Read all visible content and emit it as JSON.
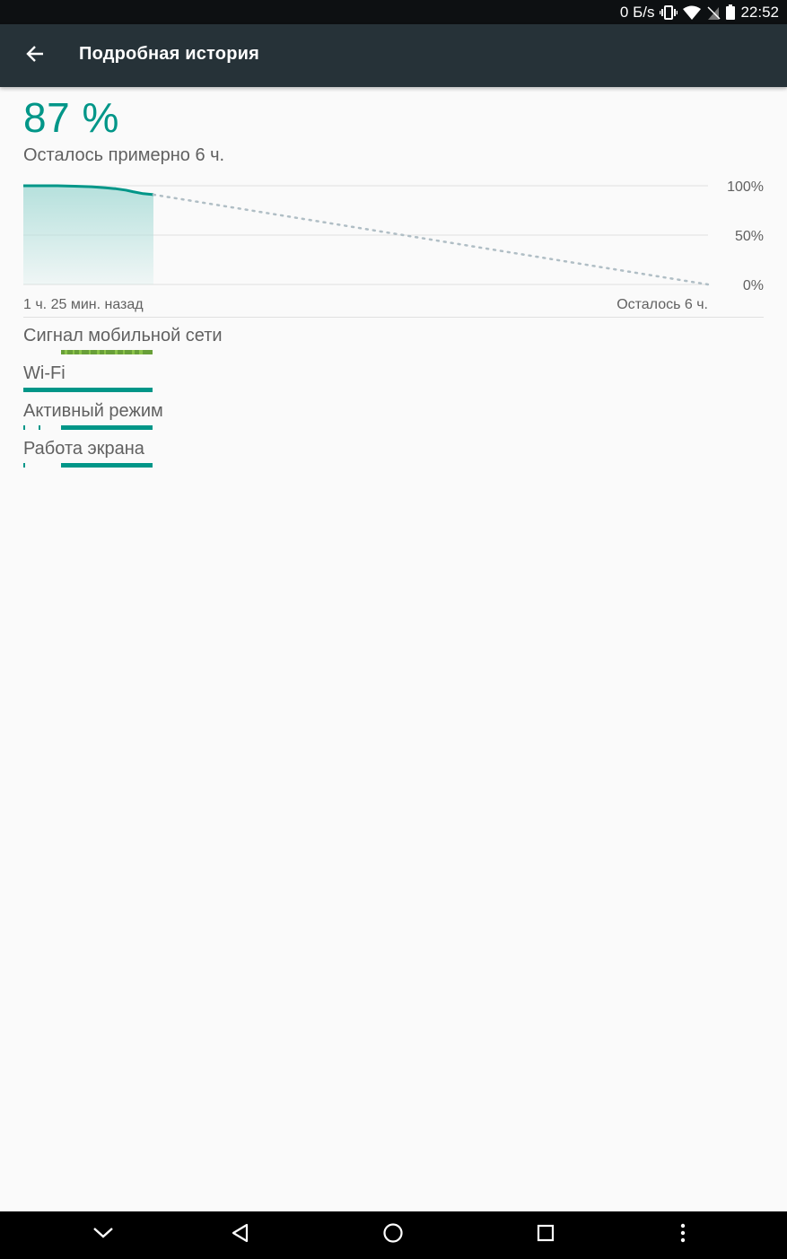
{
  "status_bar": {
    "net_speed": "0 Б/s",
    "time": "22:52",
    "icons": [
      "vibrate-icon",
      "wifi-icon",
      "no-sim-icon",
      "battery-icon"
    ]
  },
  "app_bar": {
    "back_icon": "arrow-back-icon",
    "title": "Подробная история"
  },
  "battery": {
    "level": "87 %",
    "remaining": "Осталось примерно 6 ч."
  },
  "chart_data": {
    "type": "line",
    "x_start_label": "1 ч. 25 мин. назад",
    "x_end_label": "Осталось 6 ч.",
    "y_tick_labels": [
      "100%",
      "50%",
      "0%"
    ],
    "ylim": [
      0,
      100
    ],
    "xlim": [
      0,
      1
    ],
    "actual": {
      "x": [
        0.0,
        0.025,
        0.05,
        0.075,
        0.1,
        0.12,
        0.135,
        0.15,
        0.16,
        0.175,
        0.19
      ],
      "y": [
        100,
        100,
        100,
        99.5,
        99,
        98,
        97,
        95.5,
        94,
        92,
        91
      ]
    },
    "projected": {
      "x": [
        0.19,
        1.0
      ],
      "y": [
        91,
        0
      ]
    },
    "grid": true,
    "colors": {
      "line": "#009688",
      "fill": "#b2dfdb",
      "projection": "#b0bec5",
      "grid": "#e0e0e0"
    }
  },
  "rows": [
    {
      "label": "Сигнал мобильной сети",
      "type": "signal"
    },
    {
      "label": "Wi-Fi",
      "type": "wifi"
    },
    {
      "label": "Активный режим",
      "type": "active"
    },
    {
      "label": "Работа экрана",
      "type": "screen"
    }
  ],
  "nav_bar": {
    "buttons": [
      "chevron-down-icon",
      "back-triangle-icon",
      "home-circle-icon",
      "recents-square-icon",
      "overflow-menu-icon"
    ]
  },
  "colors": {
    "accent": "#009688",
    "app_bar": "#263238",
    "status_bar": "#0d1012",
    "signal_green": "#689f38",
    "signal_light": "#8bc34a"
  }
}
